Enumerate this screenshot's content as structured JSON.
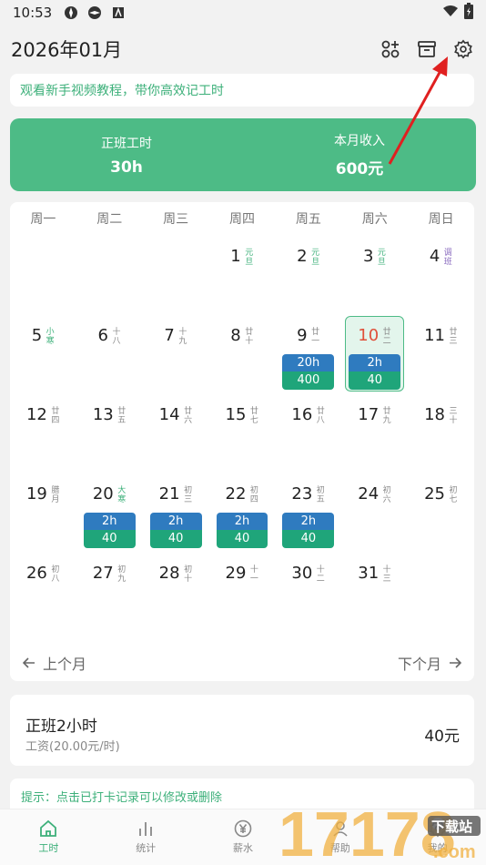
{
  "status": {
    "time": "10:53"
  },
  "header": {
    "title": "2026年01月"
  },
  "tutorial": {
    "text": "观看新手视频教程，带你高效记工时"
  },
  "summary": {
    "hours_label": "正班工时",
    "hours_value": "30h",
    "income_label": "本月收入",
    "income_value": "600元"
  },
  "weekdays": [
    "周一",
    "周二",
    "周三",
    "周四",
    "周五",
    "周六",
    "周日"
  ],
  "days": [
    {
      "d": "",
      "l": ""
    },
    {
      "d": "",
      "l": ""
    },
    {
      "d": "",
      "l": ""
    },
    {
      "d": "1",
      "l": "元旦",
      "c": "green"
    },
    {
      "d": "2",
      "l": "元旦",
      "c": "green"
    },
    {
      "d": "3",
      "l": "元旦",
      "c": "green"
    },
    {
      "d": "4",
      "l": "调班",
      "c": "purple"
    },
    {
      "d": "5",
      "l": "小寒",
      "c": "green"
    },
    {
      "d": "6",
      "l": "十八"
    },
    {
      "d": "7",
      "l": "十九"
    },
    {
      "d": "8",
      "l": "廿十"
    },
    {
      "d": "9",
      "l": "廿一",
      "h": "20h",
      "a": "400"
    },
    {
      "d": "10",
      "l": "廿二",
      "h": "2h",
      "a": "40",
      "today": true
    },
    {
      "d": "11",
      "l": "廿三"
    },
    {
      "d": "12",
      "l": "廿四"
    },
    {
      "d": "13",
      "l": "廿五"
    },
    {
      "d": "14",
      "l": "廿六"
    },
    {
      "d": "15",
      "l": "廿七"
    },
    {
      "d": "16",
      "l": "廿八"
    },
    {
      "d": "17",
      "l": "廿九"
    },
    {
      "d": "18",
      "l": "三十"
    },
    {
      "d": "19",
      "l": "腊月"
    },
    {
      "d": "20",
      "l": "大寒",
      "c": "green",
      "h": "2h",
      "a": "40"
    },
    {
      "d": "21",
      "l": "初三",
      "h": "2h",
      "a": "40"
    },
    {
      "d": "22",
      "l": "初四",
      "h": "2h",
      "a": "40"
    },
    {
      "d": "23",
      "l": "初五",
      "h": "2h",
      "a": "40"
    },
    {
      "d": "24",
      "l": "初六"
    },
    {
      "d": "25",
      "l": "初七"
    },
    {
      "d": "26",
      "l": "初八"
    },
    {
      "d": "27",
      "l": "初九"
    },
    {
      "d": "28",
      "l": "初十"
    },
    {
      "d": "29",
      "l": "十一"
    },
    {
      "d": "30",
      "l": "十二"
    },
    {
      "d": "31",
      "l": "十三"
    },
    {
      "d": "",
      "l": ""
    }
  ],
  "monthnav": {
    "prev": "上个月",
    "next": "下个月"
  },
  "record": {
    "title": "正班2小时",
    "sub": "工资(20.00元/时)",
    "amount": "40元"
  },
  "tip": {
    "text": "提示：点击已打卡记录可以修改或删除"
  },
  "bottomnav": [
    {
      "label": "工时",
      "icon": "home-icon",
      "active": true
    },
    {
      "label": "统计",
      "icon": "bar-chart-icon"
    },
    {
      "label": "薪水",
      "icon": "yen-icon"
    },
    {
      "label": "帮助",
      "icon": "person-icon"
    },
    {
      "label": "我的",
      "icon": "gear-icon"
    }
  ],
  "watermark": {
    "text": "17178",
    "small": "下载站",
    "site": ".com"
  },
  "colors": {
    "accent": "#4dbb86",
    "blue": "#2f7bbf",
    "teal": "#1fa57a",
    "today": "#e0503a",
    "arrow": "#e02020"
  }
}
